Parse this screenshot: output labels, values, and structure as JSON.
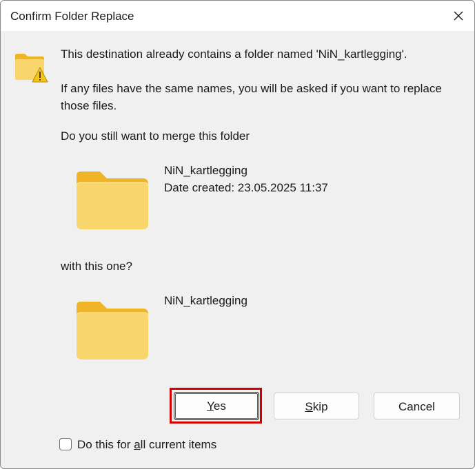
{
  "dialog": {
    "title": "Confirm Folder Replace",
    "close_icon": "close-icon",
    "message": "This destination already contains a folder named 'NiN_kartlegging'.",
    "note": "If any files have the same names, you will be asked if you want to replace those files.",
    "question": "Do you still want to merge this folder",
    "source_folder": {
      "name": "NiN_kartlegging",
      "date_created": "Date created: 23.05.2025 11:37"
    },
    "with_this_one": "with this one?",
    "destination_folder": {
      "name": "NiN_kartlegging"
    },
    "buttons": {
      "yes": {
        "before": "",
        "accel": "Y",
        "after": "es"
      },
      "skip": {
        "before": "",
        "accel": "S",
        "after": "kip"
      },
      "cancel": "Cancel"
    },
    "apply_all": {
      "before": "Do this for ",
      "accel": "a",
      "after": "ll current items",
      "checked": false
    }
  },
  "colors": {
    "highlight": "#d40000",
    "folder_front": "#f9d66b",
    "folder_back": "#f0b429"
  }
}
